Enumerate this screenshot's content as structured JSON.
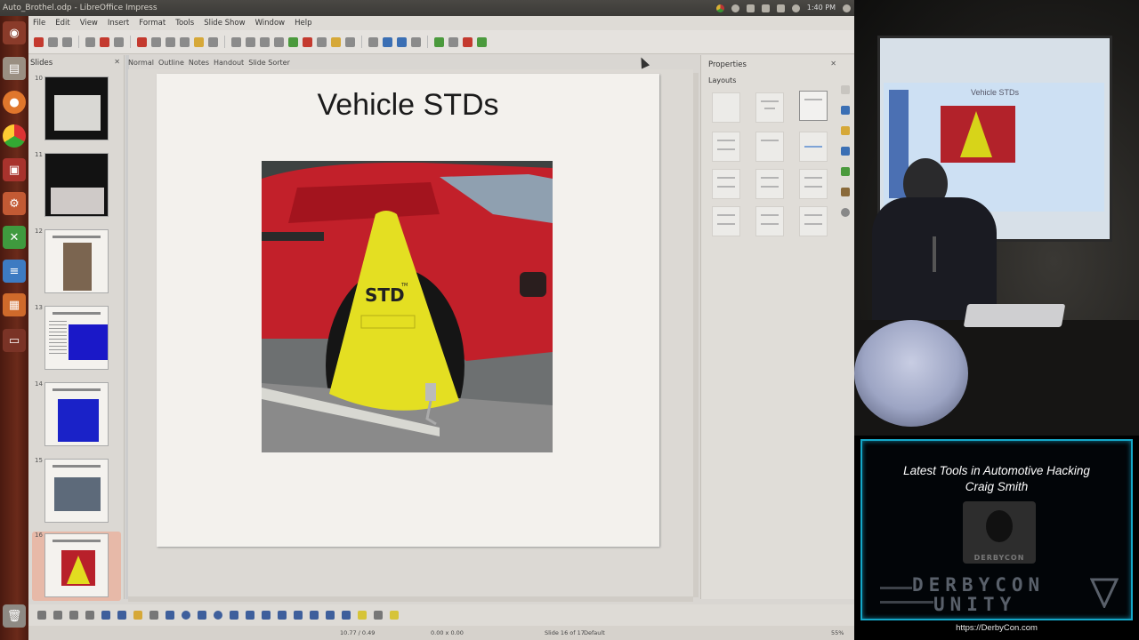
{
  "window": {
    "title": "Auto_Brothel.odp - LibreOffice Impress",
    "clock": "1:40 PM"
  },
  "menu": [
    "File",
    "Edit",
    "View",
    "Insert",
    "Format",
    "Tools",
    "Slide Show",
    "Window",
    "Help"
  ],
  "slides_pane": {
    "title": "Slides",
    "thumbnails": [
      {
        "number": "10",
        "selected": false
      },
      {
        "number": "11",
        "selected": false
      },
      {
        "number": "12",
        "selected": false
      },
      {
        "number": "13",
        "selected": false
      },
      {
        "number": "14",
        "selected": false
      },
      {
        "number": "15",
        "selected": false
      },
      {
        "number": "16",
        "selected": true
      }
    ]
  },
  "view_tabs": [
    "Normal",
    "Outline",
    "Notes",
    "Handout",
    "Slide Sorter"
  ],
  "slide": {
    "title": "Vehicle STDs",
    "photo_label": "STD",
    "photo_tm": "TM"
  },
  "properties": {
    "title": "Properties",
    "section": "Layouts"
  },
  "statusbar": {
    "position": "10.77 / 0.49",
    "size": "0.00 x 0.00",
    "slide": "Slide 16 of 17",
    "layout": "Default",
    "zoom": "55%"
  },
  "presentation": {
    "projected_title": "Vehicle STDs",
    "talk_title": "Latest Tools in Automotive Hacking",
    "speaker": "Craig Smith",
    "logo_text": "DERBYCON",
    "brand_line1": "DERBYCON",
    "brand_line2": "UNITY",
    "url": "https://DerbyCon.com"
  },
  "colors": {
    "ubuntu_launcher": "#6b2a1a",
    "accent_frame": "#14a7c8",
    "car_red": "#c2202a",
    "boot_yellow": "#e4df22"
  }
}
